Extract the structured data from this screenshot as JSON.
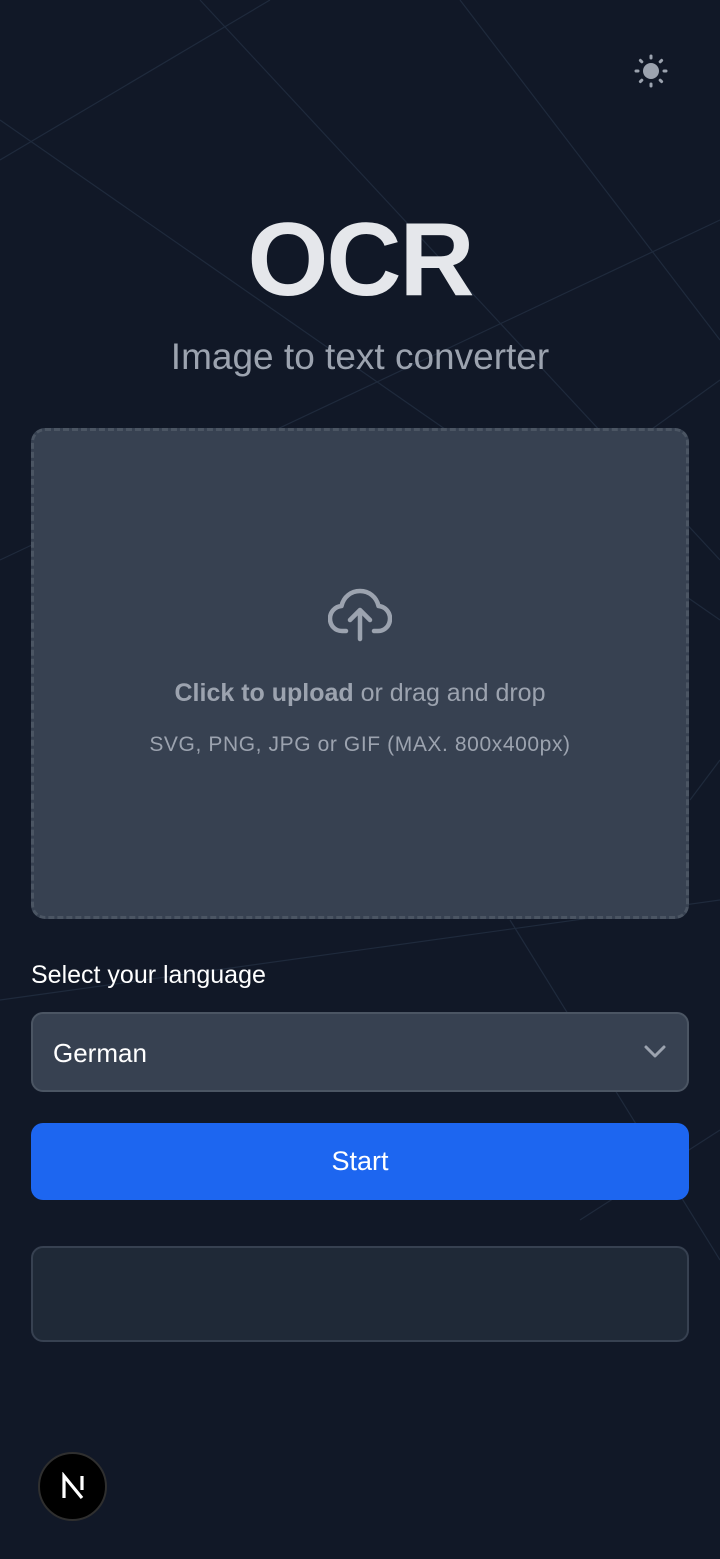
{
  "header": {
    "theme_toggle_icon": "sun-icon"
  },
  "hero": {
    "title": "OCR",
    "subtitle": "Image to text converter"
  },
  "upload": {
    "icon": "cloud-upload-icon",
    "click_text": "Click to upload",
    "drag_text": " or drag and drop",
    "hint": "SVG, PNG, JPG or GIF (MAX. 800x400px)"
  },
  "language": {
    "label": "Select your language",
    "selected": "German",
    "dropdown_icon": "chevron-down-icon"
  },
  "actions": {
    "start_label": "Start"
  },
  "output": {
    "text": ""
  },
  "footer": {
    "badge_icon": "nextjs-logo-icon"
  },
  "colors": {
    "background": "#111827",
    "panel": "#374151",
    "accent": "#1d66f0",
    "output_bg": "#1f2937"
  }
}
